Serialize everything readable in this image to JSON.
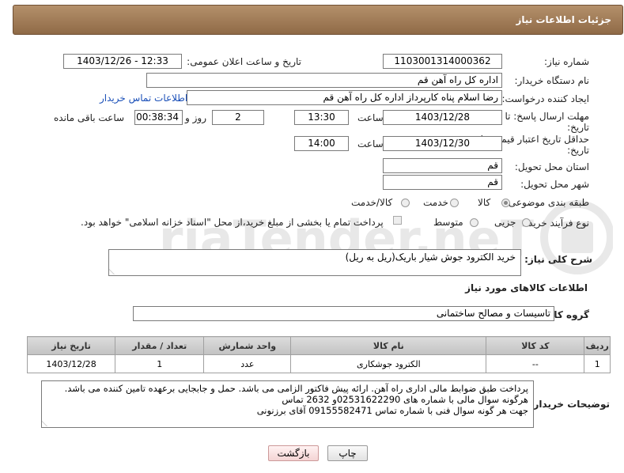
{
  "header": {
    "title": "جزئیات اطلاعات نیاز"
  },
  "form": {
    "need_number_label": "شماره نیاز:",
    "need_number": "1103001314000362",
    "announce_label": "تاریخ و ساعت اعلان عمومی:",
    "announce_value": "1403/12/26 - 12:33",
    "buyer_org_label": "نام دستگاه خریدار:",
    "buyer_org": "اداره کل  راه آهن قم",
    "creator_label": "ایجاد کننده درخواست:",
    "creator": "رضا اسلام پناه کارپرداز اداره کل  راه آهن قم",
    "contact_link": "اطلاعات تماس خریدار",
    "deadline_label_1": "مهلت ارسال پاسخ: تا",
    "deadline_label_2": "تاریخ:",
    "deadline_date": "1403/12/28",
    "time_label": "ساعت",
    "deadline_time": "13:30",
    "days_value": "2",
    "days_label": "روز و",
    "remaining_time": "00:38:34",
    "remaining_label": "ساعت باقی مانده",
    "validity_label_1": "حداقل تاریخ اعتبار قیمت: تا",
    "validity_label_2": "تاریخ:",
    "validity_date": "1403/12/30",
    "validity_time": "14:00",
    "province_label": "استان محل تحویل:",
    "province": "قم",
    "city_label": "شهر محل تحویل:",
    "city": "قم",
    "category_label": "طبقه بندی موضوعی:",
    "category_options": [
      "کالا",
      "خدمت",
      "کالا/خدمت"
    ],
    "process_label": "نوع فرآیند خرید :",
    "process_options": [
      "جزیی",
      "متوسط"
    ],
    "payment_note": "پرداخت تمام یا بخشی از مبلغ خرید،از محل \"اسناد خزانه اسلامی\" خواهد بود.",
    "summary_label": "شرح کلی نیاز:",
    "summary": "خرید الکترود جوش شیار باریک(ریل به ریل)",
    "goods_info_title": "اطلاعات کالاهای مورد نیاز",
    "goods_group_label": "گروه کالا:",
    "goods_group": "تاسیسات و مصالح ساختمانی",
    "buyer_notes_label": "توضیحات خریدار:",
    "buyer_notes": [
      "پرداخت طبق ضوابط مالی اداری راه آهن. ارائه پیش فاکتور الزامی می باشد. حمل و جابجایی برعهده تامین کننده می باشد.",
      "هرگونه سوال مالی با شماره های 02531622290و 2632 تماس",
      "جهت هر گونه سوال فنی با شماره تماس 09155582471 آقای برزنونی"
    ]
  },
  "table": {
    "headers": [
      "ردیف",
      "کد کالا",
      "نام کالا",
      "واحد شمارش",
      "تعداد / مقدار",
      "تاریخ نیاز"
    ],
    "rows": [
      [
        "1",
        "--",
        "الکترود جوشکاری",
        "عدد",
        "1",
        "1403/12/28"
      ]
    ]
  },
  "buttons": {
    "print": "چاپ",
    "back": "بازگشت"
  },
  "watermark": {
    "brand": "AriaTender.neT"
  }
}
